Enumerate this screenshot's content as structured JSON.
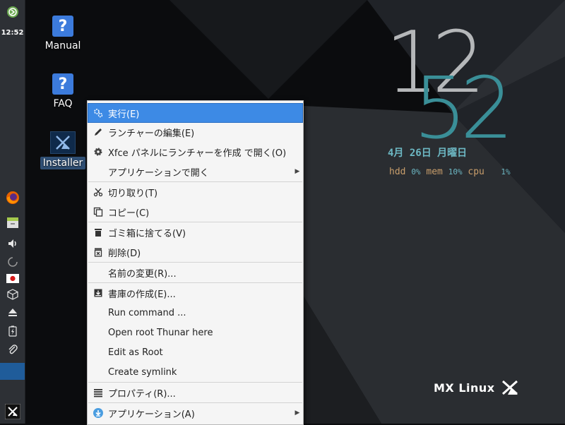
{
  "panel": {
    "clock": "12:52",
    "top_icon": "mx-updater-icon",
    "launchers": [
      {
        "name": "firefox-icon"
      },
      {
        "name": "file-manager-icon"
      },
      {
        "name": "volume-icon"
      },
      {
        "name": "network-spinner-icon"
      },
      {
        "name": "keyboard-layout-jp-icon"
      },
      {
        "name": "package-box-icon"
      },
      {
        "name": "eject-icon"
      },
      {
        "name": "power-battery-icon"
      },
      {
        "name": "clipboard-clip-icon"
      }
    ],
    "whisker_icon": "mx-menu-icon"
  },
  "desktop_icons": [
    {
      "label": "Manual",
      "icon": "help-question-icon"
    },
    {
      "label": "FAQ",
      "icon": "help-question-icon"
    },
    {
      "label": "Installer",
      "icon": "mx-installer-icon",
      "selected": true
    }
  ],
  "conky": {
    "hour": "12",
    "minute": "52",
    "date": "4月 26日 月曜日",
    "stats": {
      "hdd_label": "hdd",
      "hdd_value": "0%",
      "mem_label": "mem",
      "mem_value": "10%",
      "cpu_label": "cpu",
      "cpu_value": "1%"
    },
    "brand": "MX Linux"
  },
  "context_menu": {
    "items": [
      {
        "label": "実行(E)",
        "icon": "execute-gear-icon",
        "highlighted": true
      },
      {
        "label": "ランチャーの編集(E)",
        "icon": "pencil-edit-icon"
      },
      {
        "label": "Xfce パネルにランチャーを作成 で開く(O)",
        "icon": "settings-gear-icon"
      },
      {
        "label": "アプリケーションで開く",
        "icon": "",
        "submenu": true
      },
      {
        "label": "切り取り(T)",
        "icon": "scissors-icon"
      },
      {
        "label": "コピー(C)",
        "icon": "copy-icon"
      },
      {
        "label": "ゴミ箱に捨てる(V)",
        "icon": "trash-icon"
      },
      {
        "label": "削除(D)",
        "icon": "delete-icon"
      },
      {
        "label": "名前の変更(R)...",
        "icon": ""
      },
      {
        "label": "書庫の作成(E)...",
        "icon": "archive-icon"
      },
      {
        "label": "Run command ...",
        "icon": ""
      },
      {
        "label": "Open root Thunar here",
        "icon": ""
      },
      {
        "label": "Edit as Root",
        "icon": ""
      },
      {
        "label": "Create symlink",
        "icon": ""
      },
      {
        "label": "プロパティ(R)...",
        "icon": "properties-list-icon"
      },
      {
        "label": "アプリケーション(A)",
        "icon": "applications-download-icon",
        "submenu": true
      }
    ]
  },
  "colors": {
    "panel_bg": "#2d3035",
    "highlight": "#3d8ae5",
    "clock_hour": "#b5b7b9",
    "clock_minute": "#3a8f98",
    "date": "#6db8c4",
    "stat_label": "#c99e6b"
  }
}
